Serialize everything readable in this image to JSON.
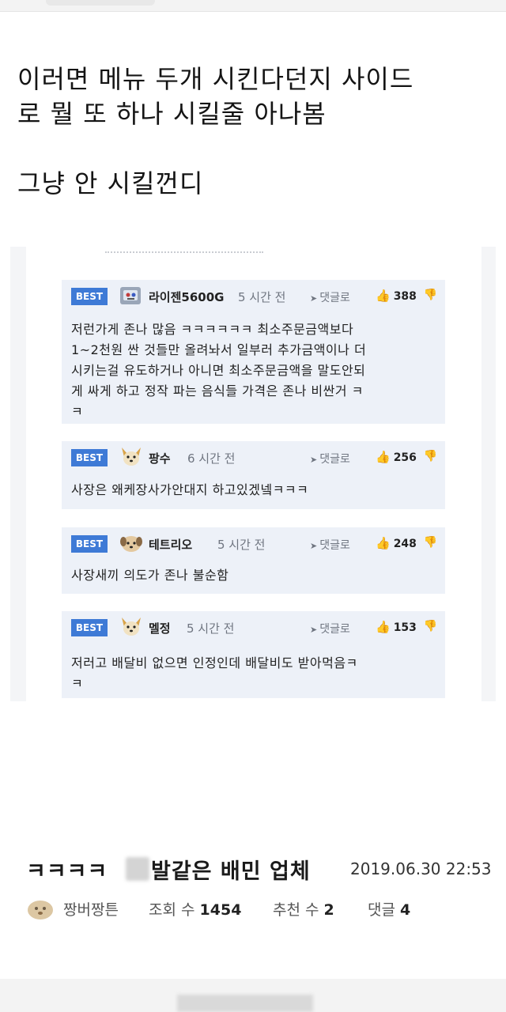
{
  "post": {
    "line1": "이러면 메뉴 두개 시킨다던지 사이드",
    "line2": "로 뭘 또 하나 시킬줄 아나봄",
    "line3": "그냥 안 시킬껀디"
  },
  "comments": [
    {
      "badge": "BEST",
      "user": "라이젠5600G",
      "time": "5 시간 전",
      "reply": "댓글로",
      "likes": "388",
      "avatar_icon": "robot-avatar-icon",
      "lines": [
        "저런가게 존나 많음 ㅋㅋㅋㅋㅋㅋ 최소주문금액보다",
        "1~2천원 싼 것들만 올려놔서 일부러 추가금액이나 더",
        "시키는걸 유도하거나 아니면 최소주문금액을 말도안되",
        "게 싸게 하고 정작 파는 음식들 가격은 존나 비싼거 ㅋ",
        "ㅋ"
      ]
    },
    {
      "badge": "BEST",
      "user": "팡수",
      "time": "6 시간 전",
      "reply": "댓글로",
      "likes": "256",
      "avatar_icon": "dog-avatar-icon",
      "lines": [
        "사장은 왜케장사가안대지 하고있겠넼ㅋㅋㅋ"
      ]
    },
    {
      "badge": "BEST",
      "user": "테트리오",
      "time": "5 시간 전",
      "reply": "댓글로",
      "likes": "248",
      "avatar_icon": "puppy-avatar-icon",
      "lines": [
        "사장새끼 의도가 존나 불순함"
      ]
    },
    {
      "badge": "BEST",
      "user": "멜정",
      "time": "5 시간 전",
      "reply": "댓글로",
      "likes": "153",
      "avatar_icon": "dog-avatar-icon",
      "lines": [
        "저러고 배달비 없으면 인정인데 배달비도 받아먹음ㅋ",
        "ㅋ"
      ]
    }
  ],
  "article": {
    "title_prefix": "ㅋㅋㅋㅋ",
    "title_rest": "발같은 배민 업체",
    "date": "2019.06.30 22:53",
    "author": "짱버짱튼",
    "views_label": "조회 수",
    "views": "1454",
    "recommend_label": "추천 수",
    "recommend": "2",
    "comments_label": "댓글",
    "comments": "4"
  }
}
